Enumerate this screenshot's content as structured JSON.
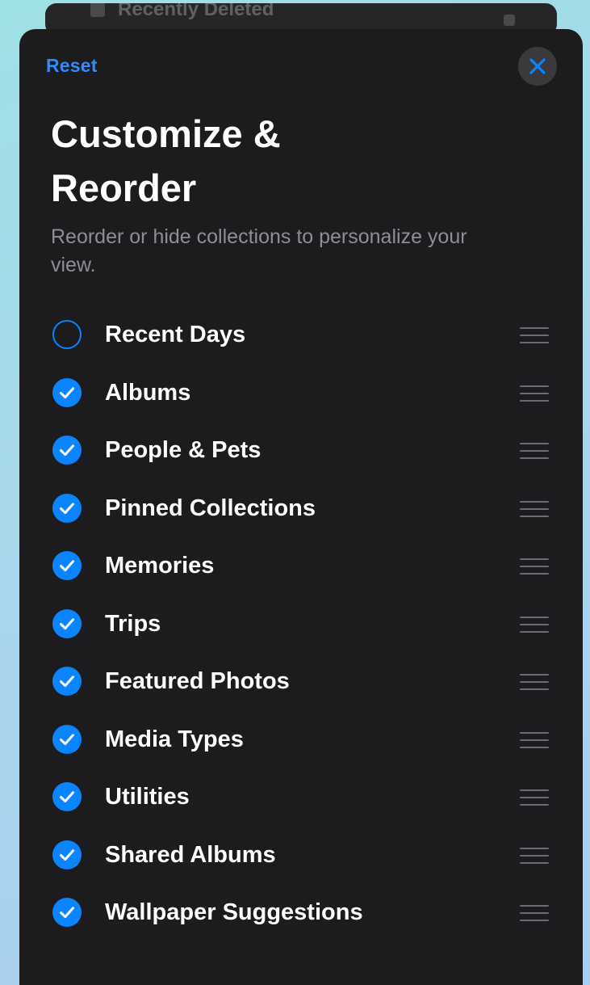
{
  "background_card": {
    "label": "Recently Deleted",
    "icon": "trash-icon"
  },
  "sheet": {
    "reset_label": "Reset",
    "close_icon": "close-icon",
    "title": "Customize & Reorder",
    "subtitle": "Reorder or hide collections to personalize your view.",
    "accent_color": "#0a84ff",
    "collections": [
      {
        "label": "Recent Days",
        "checked": false
      },
      {
        "label": "Albums",
        "checked": true
      },
      {
        "label": "People & Pets",
        "checked": true
      },
      {
        "label": "Pinned Collections",
        "checked": true
      },
      {
        "label": "Memories",
        "checked": true
      },
      {
        "label": "Trips",
        "checked": true
      },
      {
        "label": "Featured Photos",
        "checked": true
      },
      {
        "label": "Media Types",
        "checked": true
      },
      {
        "label": "Utilities",
        "checked": true
      },
      {
        "label": "Shared Albums",
        "checked": true
      },
      {
        "label": "Wallpaper Suggestions",
        "checked": true
      }
    ]
  }
}
